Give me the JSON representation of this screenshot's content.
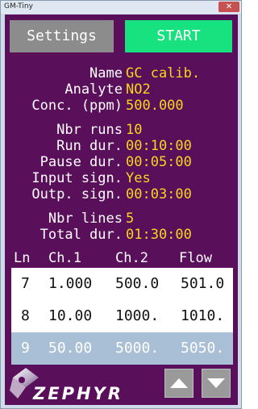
{
  "window": {
    "title": "GM-Tiny",
    "close_glyph": "✕"
  },
  "toolbar": {
    "settings_label": "Settings",
    "start_label": "START"
  },
  "fields": [
    {
      "label": "Name",
      "value": "GC calib."
    },
    {
      "label": "Analyte",
      "value": "NO2"
    },
    {
      "label": "Conc. (ppm)",
      "value": "500.000"
    },
    {
      "label": "Nbr runs",
      "value": "10"
    },
    {
      "label": "Run dur.",
      "value": "00:10:00"
    },
    {
      "label": "Pause dur.",
      "value": "00:05:00"
    },
    {
      "label": "Input sign.",
      "value": "Yes"
    },
    {
      "label": "Outp. sign.",
      "value": "00:03:00"
    },
    {
      "label": "Nbr lines",
      "value": "5"
    },
    {
      "label": "Total dur.",
      "value": "01:30:00"
    }
  ],
  "table": {
    "headers": [
      "Ln",
      "Ch.1",
      "Ch.2",
      "Flow"
    ],
    "rows": [
      [
        "7",
        "1.000",
        "500.0",
        "501.0"
      ],
      [
        "8",
        "10.00",
        "1000.",
        "1010."
      ],
      [
        "9",
        "50.00",
        "5000.",
        "5050."
      ]
    ],
    "selected_row": "9"
  },
  "logo": {
    "text": "ZEPHYR",
    "icon": "zephyr-logo-icon"
  },
  "nav": {
    "up_icon": "arrow-up-icon",
    "down_icon": "arrow-down-icon"
  },
  "colors": {
    "background": "#5a0f5b",
    "value_text": "#f5d71b",
    "start_button": "#17e27f",
    "settings_button": "#8c8c8c",
    "selected_row": "#a8bfd6"
  }
}
